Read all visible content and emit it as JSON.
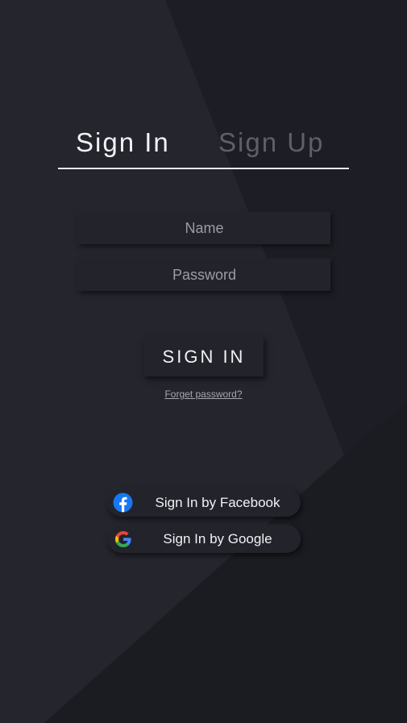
{
  "tabs": {
    "signin_label": "Sign In",
    "signup_label": "Sign Up"
  },
  "form": {
    "name_placeholder": "Name",
    "password_placeholder": "Password",
    "submit_label": "SIGN IN",
    "forget_label": "Forget password?"
  },
  "social": {
    "facebook_label": "Sign In by Facebook",
    "google_label": "Sign In by Google"
  },
  "colors": {
    "background": "#1d1e25",
    "active_tab": "#f2f2f5",
    "inactive_tab": "#5e5f68",
    "facebook": "#1877f2"
  },
  "icons": [
    "facebook-icon",
    "google-icon"
  ]
}
